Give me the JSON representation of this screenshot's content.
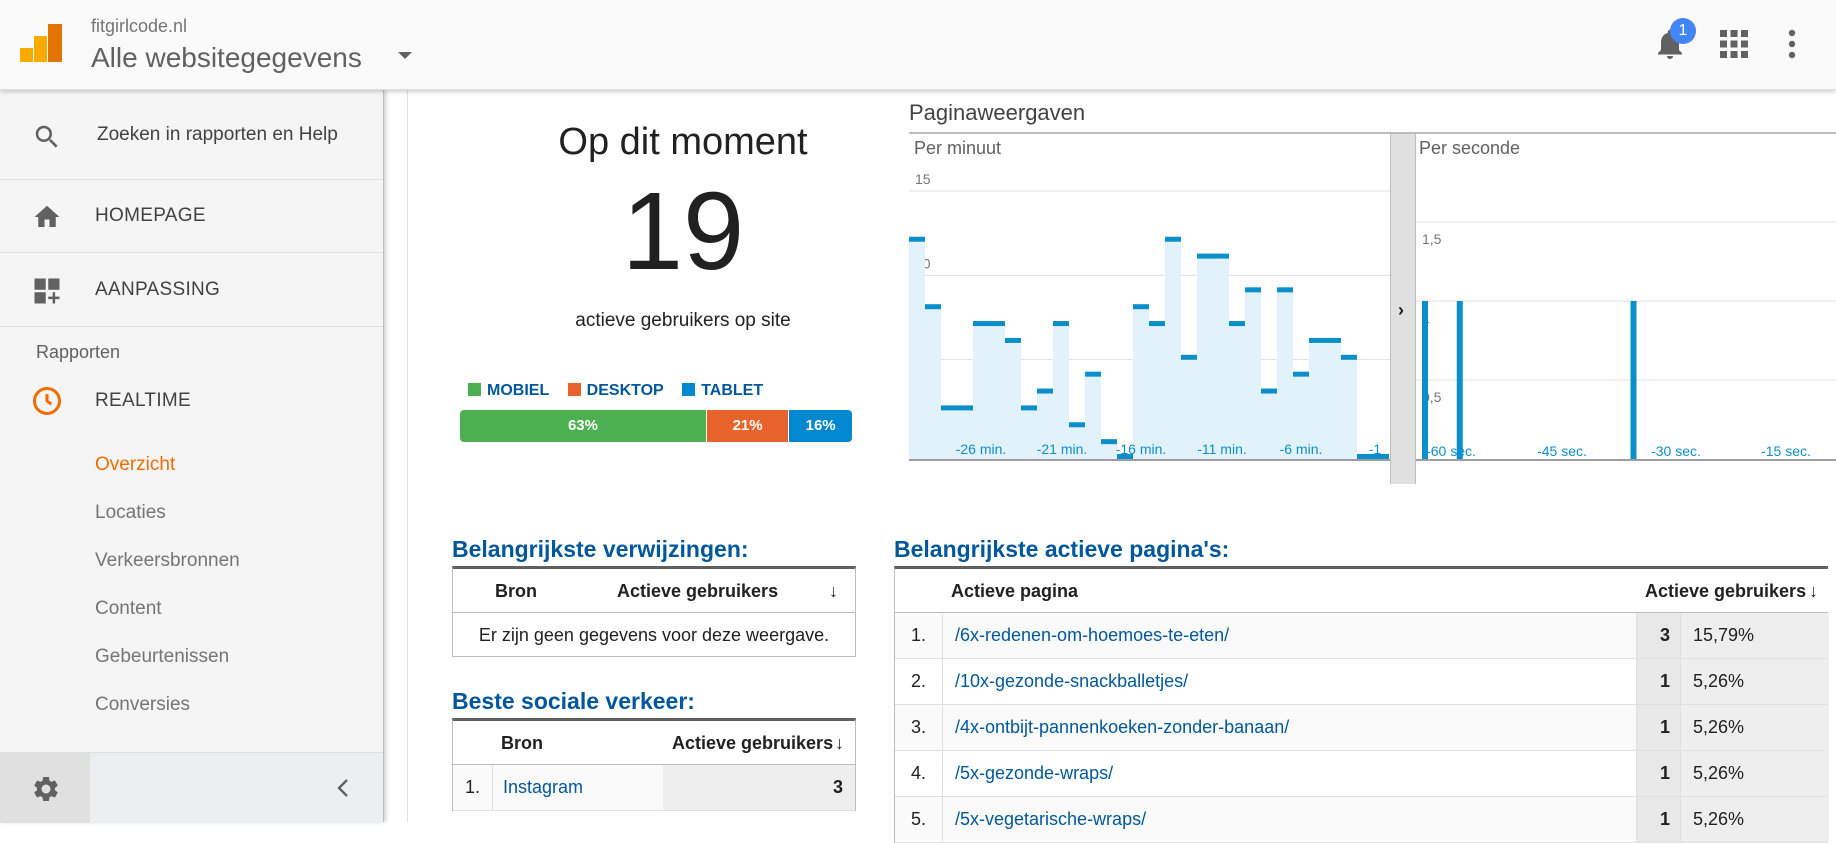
{
  "header": {
    "site": "fitgirlcode.nl",
    "view": "Alle websitegegevens",
    "notification_count": "1"
  },
  "sidebar": {
    "search_placeholder": "Zoeken in rapporten en Help",
    "nav": [
      {
        "label": "HOMEPAGE",
        "icon": "home-icon"
      },
      {
        "label": "AANPASSING",
        "icon": "dashboard-add-icon"
      }
    ],
    "section": "Rapporten",
    "realtime": {
      "label": "REALTIME",
      "icon": "clock-icon"
    },
    "subitems": [
      "Overzicht",
      "Locaties",
      "Verkeersbronnen",
      "Content",
      "Gebeurtenissen",
      "Conversies"
    ],
    "active_subitem": "Overzicht"
  },
  "summary": {
    "title": "Op dit moment",
    "count": "19",
    "subtitle": "actieve gebruikers op site",
    "devices": [
      {
        "name": "MOBIEL",
        "percent": "63%",
        "value": 63,
        "color": "#4caf50"
      },
      {
        "name": "DESKTOP",
        "percent": "21%",
        "value": 21,
        "color": "#e8632b"
      },
      {
        "name": "TABLET",
        "percent": "16%",
        "value": 16,
        "color": "#0288d1"
      }
    ]
  },
  "pageviews": {
    "title": "Paginaweergaven",
    "per_minute_label": "Per minuut",
    "per_second_label": "Per seconde"
  },
  "chart_data": [
    {
      "type": "bar",
      "title": "Per minuut",
      "x": [
        -30,
        -29,
        -28,
        -27,
        -26,
        -25,
        -24,
        -23,
        -22,
        -21,
        -20,
        -19,
        -18,
        -17,
        -16,
        -15,
        -14,
        -13,
        -12,
        -11,
        -10,
        -9,
        -8,
        -7,
        -6,
        -5,
        -4,
        -3,
        -2,
        -1
      ],
      "values": [
        13,
        9,
        3,
        3,
        8,
        8,
        7,
        3,
        4,
        8,
        2,
        5,
        1,
        0,
        9,
        8,
        13,
        6,
        12,
        12,
        8,
        10,
        4,
        10,
        5,
        7,
        7,
        6,
        0,
        0
      ],
      "x_ticks": [
        "-26 min.",
        "-21 min.",
        "-16 min.",
        "-11 min.",
        "-6 min.",
        "-1"
      ],
      "y_ticks": [
        "15",
        "10",
        "5"
      ],
      "ylim": [
        0,
        15
      ]
    },
    {
      "type": "bar",
      "title": "Per seconde",
      "x": [
        -60,
        -59,
        -58,
        -57,
        -56,
        -55,
        -54,
        -53,
        -52,
        -51,
        -50,
        -49,
        -48,
        -47,
        -46,
        -45,
        -44,
        -43,
        -42,
        -41,
        -40,
        -39,
        -38,
        -37,
        -36,
        -35,
        -34,
        -33,
        -32,
        -31,
        -30,
        -29,
        -28,
        -27,
        -26,
        -25,
        -24,
        -23,
        -22,
        -21,
        -20,
        -19,
        -18,
        -17,
        -16,
        -15,
        -14,
        -13,
        -12,
        -11,
        -10,
        -9,
        -8,
        -7,
        -6,
        -5,
        -4,
        -3,
        -2,
        -1
      ],
      "values": [
        1,
        0,
        0,
        0,
        0,
        1,
        0,
        0,
        0,
        0,
        0,
        0,
        0,
        0,
        0,
        0,
        0,
        0,
        0,
        0,
        0,
        0,
        0,
        0,
        0,
        0,
        0,
        0,
        0,
        0,
        1,
        0,
        0,
        0,
        0,
        0,
        0,
        0,
        0,
        0,
        0,
        0,
        0,
        0,
        0,
        0,
        0,
        0,
        0,
        0,
        0,
        0,
        0,
        0,
        0,
        0,
        0,
        0,
        0,
        0
      ],
      "x_ticks": [
        "-60 sec.",
        "-45 sec.",
        "-30 sec.",
        "-15 sec."
      ],
      "y_ticks": [
        "1,5",
        "1",
        "0,5"
      ],
      "ylim": [
        0,
        1.5
      ]
    }
  ],
  "referrals": {
    "title": "Belangrijkste verwijzingen:",
    "col_source": "Bron",
    "col_users": "Actieve gebruikers",
    "empty": "Er zijn geen gegevens voor deze weergave."
  },
  "social": {
    "title": "Beste sociale verkeer:",
    "col_source": "Bron",
    "col_users": "Actieve gebruikers",
    "rows": [
      {
        "rank": "1.",
        "source": "Instagram",
        "users": "3"
      }
    ]
  },
  "pages": {
    "title": "Belangrijkste actieve pagina's:",
    "col_page": "Actieve pagina",
    "col_users": "Actieve gebruikers",
    "rows": [
      {
        "rank": "1.",
        "page": "/6x-redenen-om-hoemoes-te-eten/",
        "users": "3",
        "percent": "15,79%"
      },
      {
        "rank": "2.",
        "page": "/10x-gezonde-snackballetjes/",
        "users": "1",
        "percent": "5,26%"
      },
      {
        "rank": "3.",
        "page": "/4x-ontbijt-pannenkoeken-zonder-banaan/",
        "users": "1",
        "percent": "5,26%"
      },
      {
        "rank": "4.",
        "page": "/5x-gezonde-wraps/",
        "users": "1",
        "percent": "5,26%"
      },
      {
        "rank": "5.",
        "page": "/5x-vegetarische-wraps/",
        "users": "1",
        "percent": "5,26%"
      }
    ]
  }
}
